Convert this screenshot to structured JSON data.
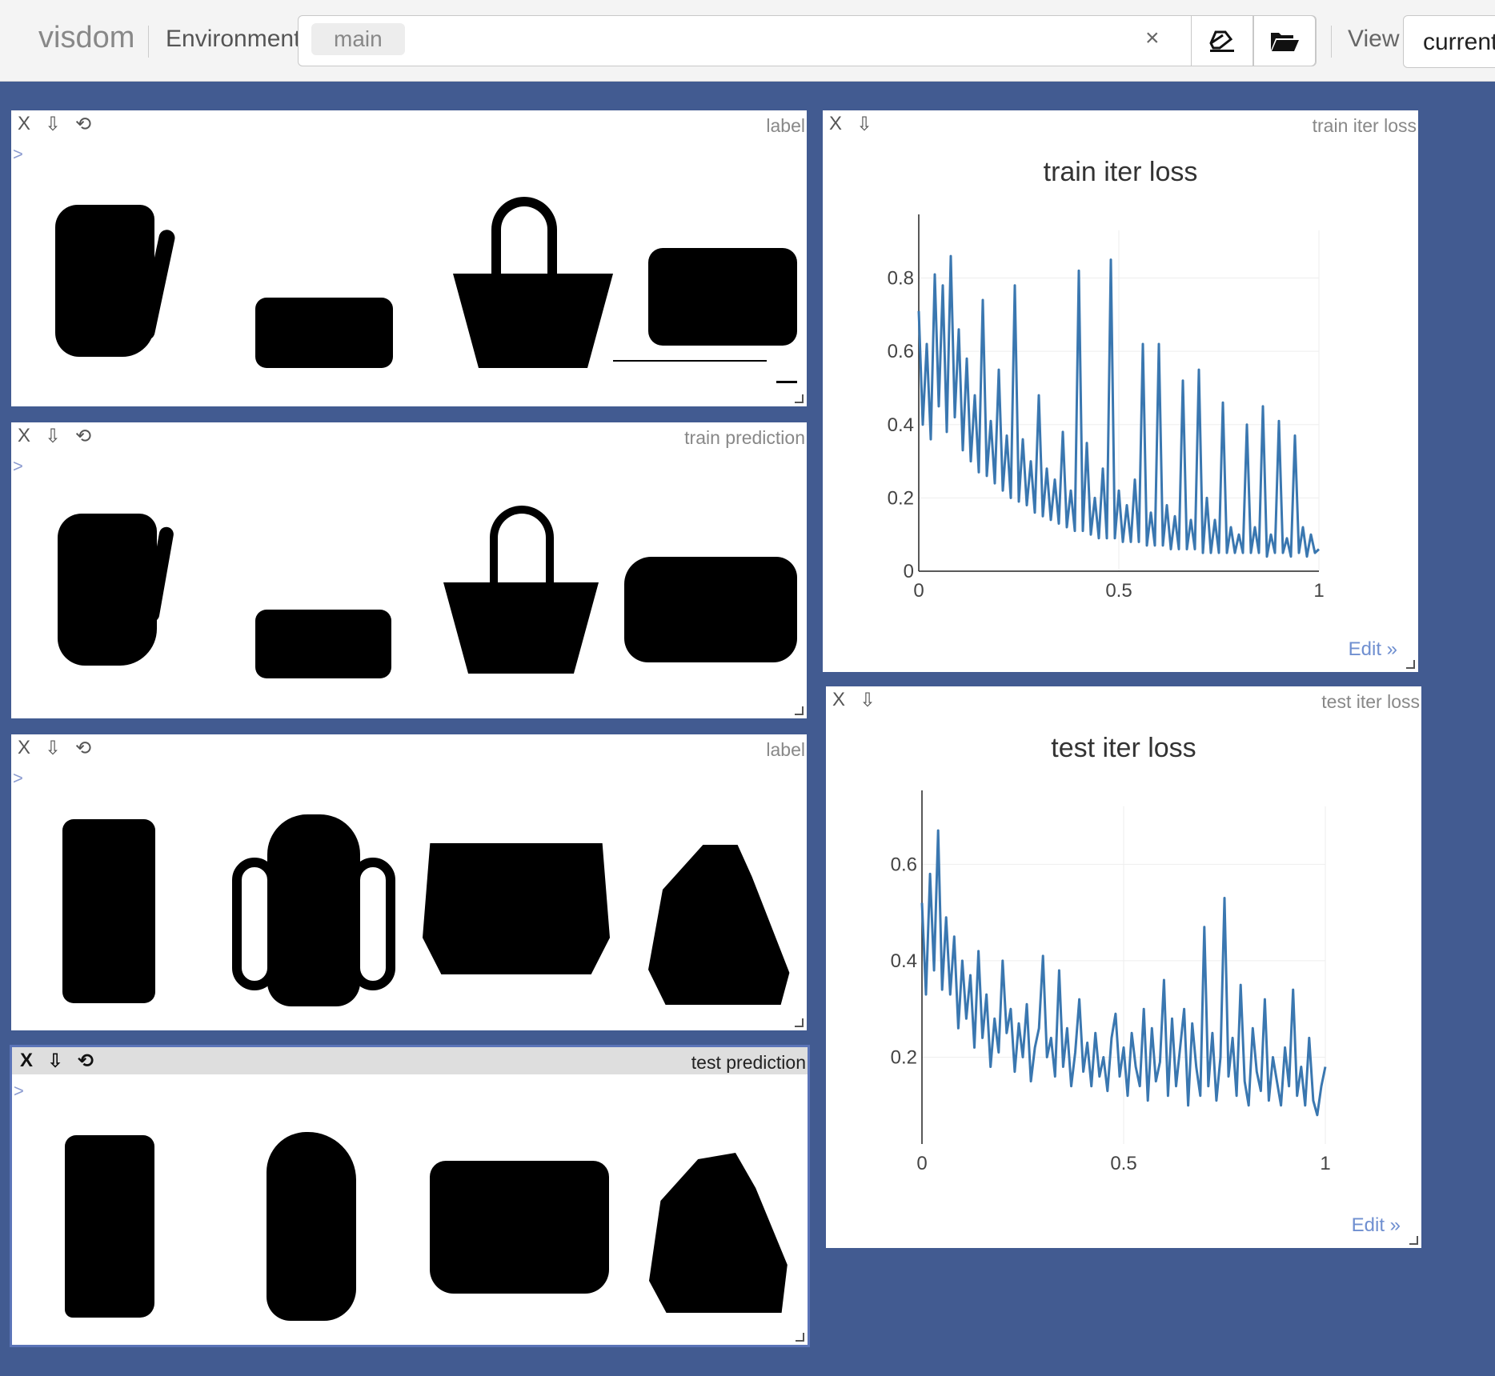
{
  "app": {
    "brand": "visdom"
  },
  "toolbar": {
    "environment_label": "Environment",
    "environment_tag": "main",
    "clear_symbol": "×",
    "view_label": "View",
    "view_value": "current"
  },
  "pane_controls": {
    "close": "X",
    "download": "⇩",
    "reset": "⟲",
    "caret": ">"
  },
  "panes": [
    {
      "title": "label"
    },
    {
      "title": "train prediction"
    },
    {
      "title": "label"
    },
    {
      "title": "test prediction"
    }
  ],
  "plots": [
    {
      "window_title": "train iter loss",
      "edit": "Edit »"
    },
    {
      "window_title": "test iter loss",
      "edit": "Edit »"
    }
  ],
  "chart_data": [
    {
      "type": "line",
      "title": "train iter loss",
      "xlabel": "",
      "ylabel": "",
      "xlim": [
        0,
        1
      ],
      "ylim": [
        0,
        0.93
      ],
      "x_ticks": [
        "0",
        "0.5",
        "1"
      ],
      "y_ticks": [
        "0",
        "0.2",
        "0.4",
        "0.6",
        "0.8"
      ],
      "grid": true,
      "line_color": "#3a77b0",
      "series": [
        {
          "x": [
            0.0,
            0.01,
            0.02,
            0.03,
            0.04,
            0.05,
            0.06,
            0.07,
            0.08,
            0.09,
            0.1,
            0.11,
            0.12,
            0.13,
            0.14,
            0.15,
            0.16,
            0.17,
            0.18,
            0.19,
            0.2,
            0.21,
            0.22,
            0.23,
            0.24,
            0.25,
            0.26,
            0.27,
            0.28,
            0.29,
            0.3,
            0.31,
            0.32,
            0.33,
            0.34,
            0.35,
            0.36,
            0.37,
            0.38,
            0.39,
            0.4,
            0.41,
            0.42,
            0.43,
            0.44,
            0.45,
            0.46,
            0.47,
            0.48,
            0.49,
            0.5,
            0.51,
            0.52,
            0.53,
            0.54,
            0.55,
            0.56,
            0.57,
            0.58,
            0.59,
            0.6,
            0.61,
            0.62,
            0.63,
            0.64,
            0.65,
            0.66,
            0.67,
            0.68,
            0.69,
            0.7,
            0.71,
            0.72,
            0.73,
            0.74,
            0.75,
            0.76,
            0.77,
            0.78,
            0.79,
            0.8,
            0.81,
            0.82,
            0.83,
            0.84,
            0.85,
            0.86,
            0.87,
            0.88,
            0.89,
            0.9,
            0.91,
            0.92,
            0.93,
            0.94,
            0.95,
            0.96,
            0.97,
            0.98,
            0.99,
            1.0
          ],
          "y": [
            0.71,
            0.4,
            0.62,
            0.36,
            0.81,
            0.45,
            0.78,
            0.38,
            0.86,
            0.42,
            0.66,
            0.33,
            0.58,
            0.3,
            0.48,
            0.27,
            0.74,
            0.26,
            0.41,
            0.24,
            0.55,
            0.22,
            0.37,
            0.2,
            0.78,
            0.19,
            0.36,
            0.18,
            0.3,
            0.16,
            0.48,
            0.15,
            0.28,
            0.14,
            0.25,
            0.13,
            0.38,
            0.12,
            0.22,
            0.11,
            0.82,
            0.11,
            0.35,
            0.1,
            0.2,
            0.09,
            0.28,
            0.09,
            0.85,
            0.09,
            0.22,
            0.08,
            0.18,
            0.08,
            0.25,
            0.08,
            0.62,
            0.07,
            0.16,
            0.07,
            0.62,
            0.07,
            0.18,
            0.06,
            0.15,
            0.06,
            0.52,
            0.06,
            0.14,
            0.06,
            0.55,
            0.05,
            0.2,
            0.05,
            0.14,
            0.05,
            0.46,
            0.05,
            0.12,
            0.05,
            0.1,
            0.05,
            0.4,
            0.05,
            0.12,
            0.05,
            0.45,
            0.04,
            0.1,
            0.05,
            0.41,
            0.05,
            0.09,
            0.04,
            0.37,
            0.05,
            0.12,
            0.04,
            0.1,
            0.05,
            0.06
          ]
        }
      ]
    },
    {
      "type": "line",
      "title": "test iter loss",
      "xlabel": "",
      "ylabel": "",
      "xlim": [
        0,
        1
      ],
      "ylim": [
        0.02,
        0.72
      ],
      "x_ticks": [
        "0",
        "0.5",
        "1"
      ],
      "y_ticks": [
        "0.2",
        "0.4",
        "0.6"
      ],
      "grid": true,
      "line_color": "#3a77b0",
      "series": [
        {
          "x": [
            0.0,
            0.01,
            0.02,
            0.03,
            0.04,
            0.05,
            0.06,
            0.07,
            0.08,
            0.09,
            0.1,
            0.11,
            0.12,
            0.13,
            0.14,
            0.15,
            0.16,
            0.17,
            0.18,
            0.19,
            0.2,
            0.21,
            0.22,
            0.23,
            0.24,
            0.25,
            0.26,
            0.27,
            0.28,
            0.29,
            0.3,
            0.31,
            0.32,
            0.33,
            0.34,
            0.35,
            0.36,
            0.37,
            0.38,
            0.39,
            0.4,
            0.41,
            0.42,
            0.43,
            0.44,
            0.45,
            0.46,
            0.47,
            0.48,
            0.49,
            0.5,
            0.51,
            0.52,
            0.53,
            0.54,
            0.55,
            0.56,
            0.57,
            0.58,
            0.59,
            0.6,
            0.61,
            0.62,
            0.63,
            0.64,
            0.65,
            0.66,
            0.67,
            0.68,
            0.69,
            0.7,
            0.71,
            0.72,
            0.73,
            0.74,
            0.75,
            0.76,
            0.77,
            0.78,
            0.79,
            0.8,
            0.81,
            0.82,
            0.83,
            0.84,
            0.85,
            0.86,
            0.87,
            0.88,
            0.89,
            0.9,
            0.91,
            0.92,
            0.93,
            0.94,
            0.95,
            0.96,
            0.97,
            0.98,
            0.99,
            1.0
          ],
          "y": [
            0.52,
            0.33,
            0.58,
            0.38,
            0.67,
            0.34,
            0.49,
            0.33,
            0.45,
            0.26,
            0.4,
            0.28,
            0.37,
            0.22,
            0.42,
            0.24,
            0.33,
            0.18,
            0.28,
            0.21,
            0.4,
            0.25,
            0.3,
            0.17,
            0.27,
            0.2,
            0.31,
            0.15,
            0.22,
            0.26,
            0.41,
            0.2,
            0.24,
            0.16,
            0.38,
            0.18,
            0.26,
            0.14,
            0.21,
            0.32,
            0.17,
            0.23,
            0.14,
            0.25,
            0.16,
            0.2,
            0.13,
            0.24,
            0.29,
            0.16,
            0.22,
            0.12,
            0.25,
            0.18,
            0.14,
            0.3,
            0.11,
            0.26,
            0.15,
            0.19,
            0.36,
            0.12,
            0.28,
            0.14,
            0.22,
            0.3,
            0.1,
            0.27,
            0.18,
            0.12,
            0.47,
            0.14,
            0.25,
            0.11,
            0.2,
            0.53,
            0.16,
            0.24,
            0.12,
            0.35,
            0.15,
            0.1,
            0.26,
            0.17,
            0.13,
            0.32,
            0.11,
            0.2,
            0.15,
            0.1,
            0.22,
            0.14,
            0.34,
            0.12,
            0.18,
            0.1,
            0.24,
            0.11,
            0.08,
            0.14,
            0.18
          ]
        }
      ]
    }
  ]
}
